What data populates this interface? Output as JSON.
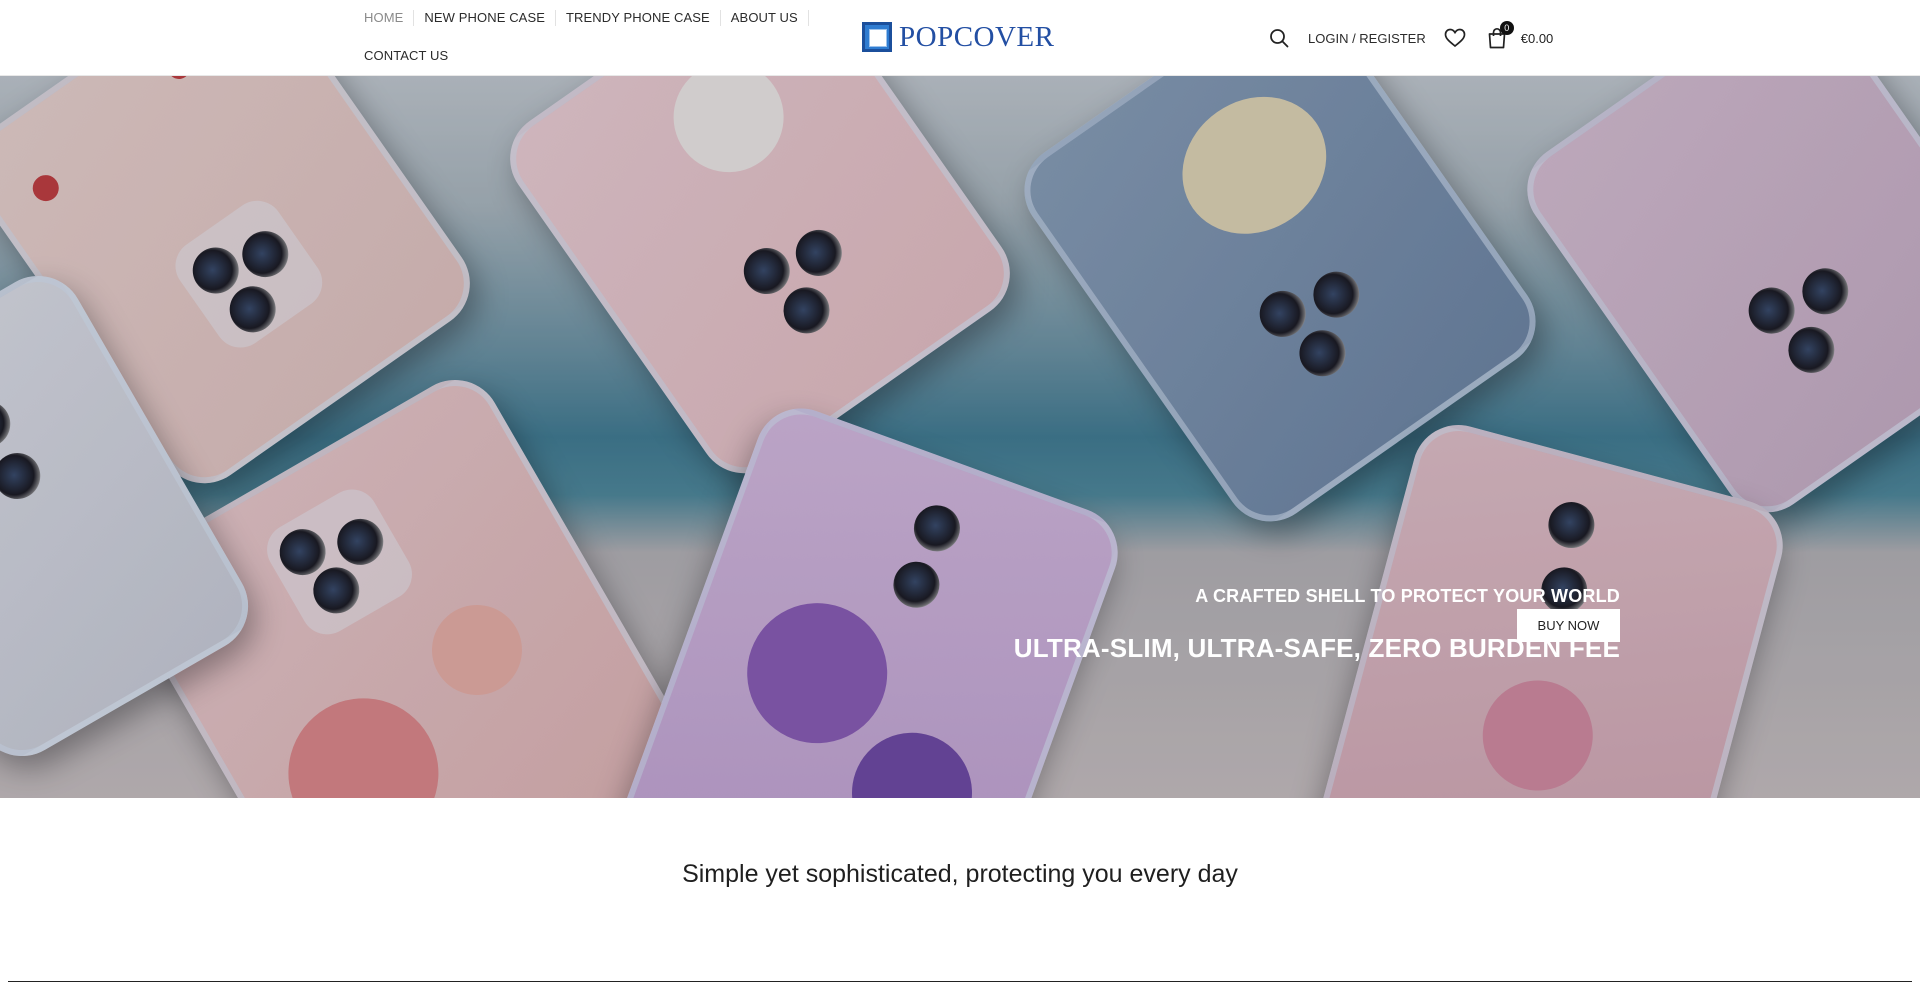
{
  "header": {
    "nav": [
      {
        "label": "HOME",
        "active": true
      },
      {
        "label": "NEW PHONE CASE"
      },
      {
        "label": "TRENDY PHONE CASE"
      },
      {
        "label": "ABOUT US"
      },
      {
        "label": "CONTACT US"
      }
    ],
    "logo_text": "POPCOVER",
    "login_label": "LOGIN / REGISTER",
    "cart_count": "0",
    "cart_total": "€0.00",
    "icons": [
      "search-icon",
      "heart-icon",
      "cart-icon"
    ]
  },
  "hero": {
    "subtitle": "A CRAFTED SHELL TO PROTECT YOUR WORLD",
    "title": "ULTRA-SLIM, ULTRA-SAFE, ZERO BURDEN FEE",
    "button_label": "BUY NOW"
  },
  "tagline": "Simple yet sophisticated, protecting you every day",
  "colors": {
    "logo_blue": "#234fa3",
    "text_dark": "#222222",
    "nav_active": "#8a8a8a"
  }
}
